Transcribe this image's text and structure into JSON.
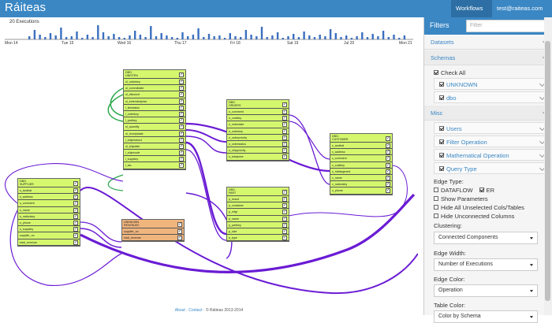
{
  "navbar": {
    "brand": "Ráiteas",
    "workflows": "Workflows",
    "user": "test@raiteas.com"
  },
  "timeline": {
    "title": "20 Executions",
    "labels": [
      "Mon 14",
      "Tue 15",
      "Wed 16",
      "Thu 17",
      "Fri 18",
      "Sat 19",
      "Jul 20",
      "Mon 21"
    ]
  },
  "nodes": [
    {
      "id": "unisten",
      "title": "DBO.\nUNISTEN",
      "rows": [
        "ol_orderkey",
        "ol_commitdate",
        "ol_discount",
        "ol_extendedprice",
        "l_linestatus",
        "l_orderkey",
        "l_partkey",
        "ol_quantity",
        "ol_receiptdate",
        "l_shipinstruct",
        "ol_shipdate",
        "l_shipmode",
        "l_suppkey",
        "l_tax"
      ]
    },
    {
      "id": "orders",
      "title": "DBO.\nORDERS",
      "rows": [
        "o_comment",
        "o_custkey",
        "o_orderdate",
        "o_orderkey",
        "o_orderpriority",
        "o_orderstatus",
        "o_shippriority",
        "o_totalprice"
      ]
    },
    {
      "id": "customer",
      "title": "DBO.\nCUSTOMER",
      "rows": [
        "c_acctbal",
        "c_address",
        "c_comment",
        "c_custkey",
        "c_mktsegment",
        "c_name",
        "c_nationkey",
        "c_phone"
      ]
    },
    {
      "id": "supplier",
      "title": "DBO.\nSUPPLIER",
      "rows": [
        "s_acctbal",
        "s_address",
        "s_comment",
        "s_name",
        "s_nationkey",
        "s_phone",
        "s_suppkey",
        "supplier_no",
        "total_revenue"
      ]
    },
    {
      "id": "part",
      "title": "DBO.\nPART",
      "rows": [
        "p_brand",
        "p_container",
        "p_mfgr",
        "p_name",
        "p_partkey",
        "p_size",
        "p_type"
      ]
    },
    {
      "id": "revenue",
      "title": "UNKNOWN.\nREVENUE0",
      "rows": [
        "supplier_no",
        "total_revenue"
      ],
      "orange": true
    }
  ],
  "footer": {
    "about": "About",
    "contact": "Contact",
    "copy": "© Ráiteas 2013-2014"
  },
  "sidebar": {
    "title": "Filters",
    "search_placeholder": "Filter",
    "datasets": "Datasets",
    "schemas": "Schemas",
    "check_all": "Check All",
    "schema_items": [
      "UNKNOWN",
      "dbo"
    ],
    "misc": "Misc",
    "misc_items": [
      "Users",
      "Filter Operation",
      "Mathematical Operation",
      "Query Type"
    ],
    "edge_type_label": "Edge Type:",
    "dataflow": "DATAFLOW",
    "er": "ER",
    "show_parameters": "Show Parameters",
    "hide_unselected": "Hide All Unselected Cols/Tables",
    "hide_unconnected": "Hide Unconnected Columns",
    "clustering_label": "Clustering:",
    "clustering_value": "Connected Components",
    "edge_width_label": "Edge Width:",
    "edge_width_value": "Number of Executions",
    "edge_color_label": "Edge Color:",
    "edge_color_value": "Operation",
    "table_color_label": "Table Color:",
    "table_color_value": "Color by Schema"
  },
  "colors": {
    "navbar": "#3a87c4",
    "node": "#d4f76e",
    "node_unknown": "#f0b57d",
    "edge": "#6a1bd4",
    "edge_alt": "#2aa84a"
  }
}
